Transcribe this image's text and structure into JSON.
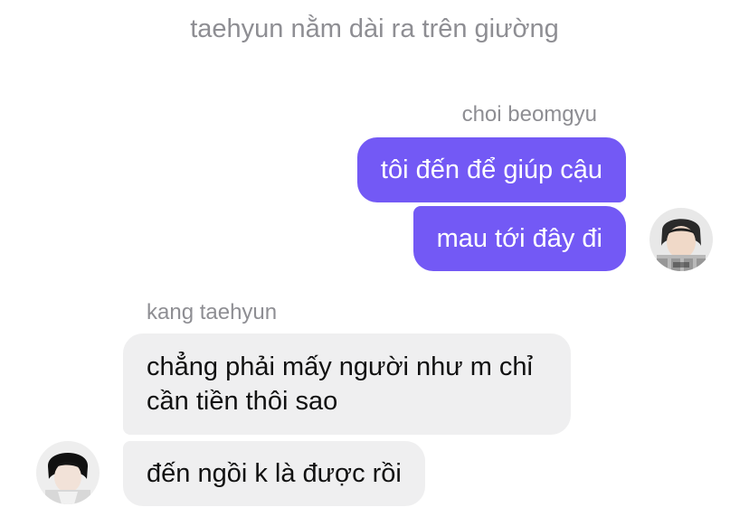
{
  "event": {
    "text": "taehyun nằm dài ra trên giường"
  },
  "messages": [
    {
      "sender": "choi beomgyu",
      "side": "right",
      "bubbles": [
        "tôi đến để giúp cậu",
        "mau tới đây đi"
      ]
    },
    {
      "sender": "kang taehyun",
      "side": "left",
      "bubbles": [
        "chẳng phải mấy người như m chỉ cần tiền thôi sao",
        "đến ngồi k là được rồi"
      ]
    }
  ],
  "colors": {
    "outgoing_bubble": "#7359f5",
    "incoming_bubble": "#efeff0",
    "meta_text": "#8e8e93"
  },
  "icons": {
    "right_avatar": "avatar-photo",
    "left_avatar": "avatar-photo"
  }
}
